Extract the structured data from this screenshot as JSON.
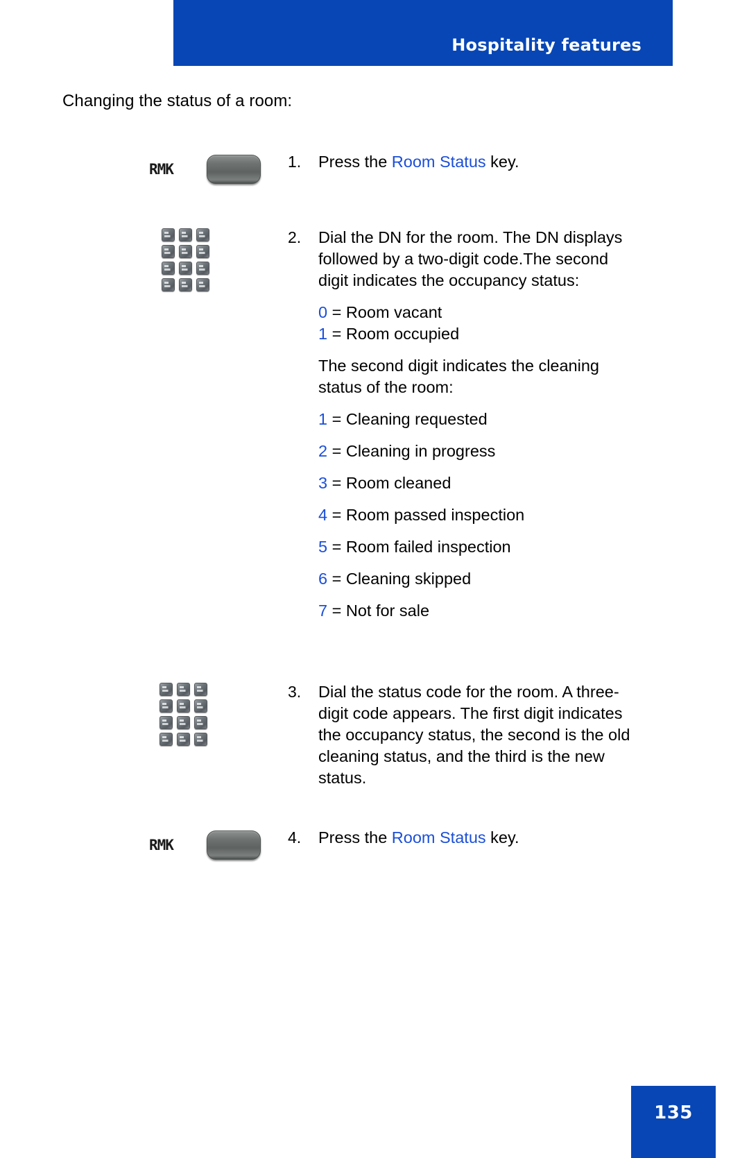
{
  "header": {
    "title": "Hospitality features"
  },
  "intro": "Changing the status of a room:",
  "steps": [
    {
      "number": "1.",
      "icon": "room-status-key",
      "key_label": "RMK",
      "text_before": "Press the ",
      "link_text": "Room Status",
      "text_after": " key."
    },
    {
      "number": "2.",
      "icon": "dialpad",
      "text": "Dial the DN for the room. The DN displays followed by a two-digit code.The second digit indicates the occupancy status:",
      "occupancy_heading": "",
      "occupancy_codes": [
        {
          "digit": "0",
          "label": "= Room vacant"
        },
        {
          "digit": "1",
          "label": "= Room occupied"
        }
      ],
      "cleaning_intro": "The second digit indicates the cleaning status of the room:",
      "cleaning_codes": [
        {
          "digit": "1",
          "label": "= Cleaning requested"
        },
        {
          "digit": "2",
          "label": "= Cleaning in progress"
        },
        {
          "digit": "3",
          "label": "= Room cleaned"
        },
        {
          "digit": "4",
          "label": "= Room passed inspection"
        },
        {
          "digit": "5",
          "label": "= Room failed inspection"
        },
        {
          "digit": "6",
          "label": "= Cleaning skipped"
        },
        {
          "digit": "7",
          "label": "= Not for sale"
        }
      ]
    },
    {
      "number": "3.",
      "icon": "dialpad",
      "text": "Dial the status code for the room. A three-digit code appears. The first digit indicates the occupancy status, the second is the old cleaning status, and the third is the new status."
    },
    {
      "number": "4.",
      "icon": "room-status-key",
      "key_label": "RMK",
      "text_before": "Press the ",
      "link_text": "Room Status",
      "text_after": " key."
    }
  ],
  "footer": {
    "page_number": "135"
  },
  "colors": {
    "brand_blue": "#0846b5",
    "link_blue": "#1b4fd8"
  }
}
